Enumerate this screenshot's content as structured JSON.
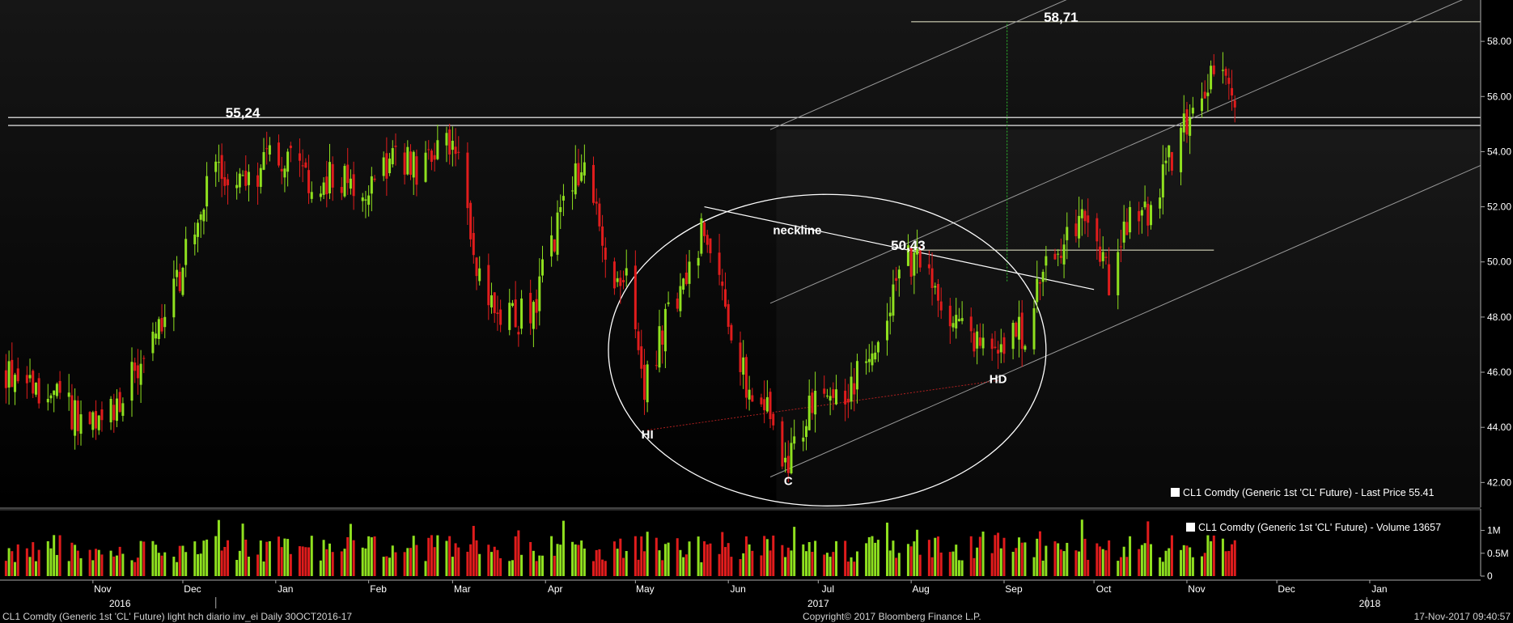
{
  "chart_data": {
    "type": "candlestick",
    "y_ticks": [
      "58.00",
      "56.00",
      "54.00",
      "52.00",
      "50.00",
      "48.00",
      "46.00",
      "44.00",
      "42.00"
    ],
    "y_tick_values": [
      58,
      56,
      54,
      52,
      50,
      48,
      46,
      44,
      42
    ],
    "ylim": [
      41.1,
      59.5
    ],
    "volume_ticks": [
      "1M",
      "0.5M",
      "0"
    ],
    "volume_tick_values": [
      1000000,
      500000,
      0
    ],
    "volume_lim": [
      0,
      1400000
    ],
    "x_months": [
      {
        "label": "Nov",
        "date": "2016-11-01"
      },
      {
        "label": "Dec",
        "date": "2016-12-01"
      },
      {
        "label": "Jan",
        "date": "2017-01-01"
      },
      {
        "label": "Feb",
        "date": "2017-02-01"
      },
      {
        "label": "Mar",
        "date": "2017-03-01"
      },
      {
        "label": "Apr",
        "date": "2017-04-01"
      },
      {
        "label": "May",
        "date": "2017-05-01"
      },
      {
        "label": "Jun",
        "date": "2017-06-01"
      },
      {
        "label": "Jul",
        "date": "2017-07-01"
      },
      {
        "label": "Aug",
        "date": "2017-08-01"
      },
      {
        "label": "Sep",
        "date": "2017-09-01"
      },
      {
        "label": "Oct",
        "date": "2017-10-01"
      },
      {
        "label": "Nov",
        "date": "2017-11-01"
      },
      {
        "label": "Dec",
        "date": "2017-12-01"
      },
      {
        "label": "Jan",
        "date": "2018-01-01"
      }
    ],
    "x_years": [
      {
        "label": "2016",
        "date": "2016-11-10"
      },
      {
        "label": "2017",
        "date": "2017-07-01"
      },
      {
        "label": "2018",
        "date": "2018-01-01"
      }
    ],
    "xlim": [
      "2016-10-01",
      "2018-02-07"
    ],
    "price_series": {
      "name": "CL1 Comdty (Generic 1st 'CL' Future) - Last Price 55.41",
      "points": [
        [
          "2016-10-01",
          46.2
        ],
        [
          "2016-10-20",
          45.0
        ],
        [
          "2016-11-03",
          43.8
        ],
        [
          "2016-11-14",
          45.8
        ],
        [
          "2016-11-25",
          47.8
        ],
        [
          "2016-11-30",
          49.4
        ],
        [
          "2016-12-06",
          51.8
        ],
        [
          "2016-12-12",
          53.2
        ],
        [
          "2016-12-22",
          52.8
        ],
        [
          "2016-12-30",
          53.7
        ],
        [
          "2017-01-06",
          53.8
        ],
        [
          "2017-01-13",
          52.4
        ],
        [
          "2017-01-20",
          53.1
        ],
        [
          "2017-01-31",
          52.8
        ],
        [
          "2017-02-10",
          53.8
        ],
        [
          "2017-02-17",
          53.4
        ],
        [
          "2017-02-27",
          54.1
        ],
        [
          "2017-03-03",
          53.5
        ],
        [
          "2017-03-08",
          50.3
        ],
        [
          "2017-03-14",
          48.3
        ],
        [
          "2017-03-22",
          47.9
        ],
        [
          "2017-03-28",
          48.4
        ],
        [
          "2017-04-04",
          51.0
        ],
        [
          "2017-04-11",
          53.4
        ],
        [
          "2017-04-17",
          52.7
        ],
        [
          "2017-04-21",
          49.6
        ],
        [
          "2017-04-28",
          49.3
        ],
        [
          "2017-05-04",
          45.5
        ],
        [
          "2017-05-11",
          47.8
        ],
        [
          "2017-05-18",
          49.3
        ],
        [
          "2017-05-24",
          51.4
        ],
        [
          "2017-05-31",
          48.3
        ],
        [
          "2017-06-07",
          45.7
        ],
        [
          "2017-06-14",
          44.7
        ],
        [
          "2017-06-21",
          42.5
        ],
        [
          "2017-06-28",
          44.6
        ],
        [
          "2017-07-05",
          45.2
        ],
        [
          "2017-07-12",
          45.4
        ],
        [
          "2017-07-19",
          46.8
        ],
        [
          "2017-07-26",
          48.7
        ],
        [
          "2017-07-31",
          50.2
        ],
        [
          "2017-08-07",
          49.4
        ],
        [
          "2017-08-14",
          47.6
        ],
        [
          "2017-08-21",
          47.4
        ],
        [
          "2017-08-28",
          46.4
        ],
        [
          "2017-09-01",
          47.3
        ],
        [
          "2017-09-08",
          47.5
        ],
        [
          "2017-09-15",
          49.9
        ],
        [
          "2017-09-22",
          50.7
        ],
        [
          "2017-09-29",
          51.7
        ],
        [
          "2017-10-06",
          49.3
        ],
        [
          "2017-10-13",
          51.5
        ],
        [
          "2017-10-20",
          51.7
        ],
        [
          "2017-10-27",
          53.9
        ],
        [
          "2017-11-03",
          55.6
        ],
        [
          "2017-11-10",
          56.7
        ],
        [
          "2017-11-13",
          56.8
        ],
        [
          "2017-11-17",
          55.4
        ]
      ]
    },
    "volume_series": {
      "name": "CL1 Comdty (Generic 1st 'CL' Future) - Volume 13657"
    },
    "annotations": [
      {
        "text": "55,24",
        "date": "2016-12-21",
        "value": 55.24
      },
      {
        "text": "58,71",
        "date": "2017-09-20",
        "value": 58.71
      },
      {
        "text": "50,43",
        "date": "2017-07-31",
        "value": 50.43
      },
      {
        "text": "neckline",
        "date": "2017-06-24",
        "value": 51.0
      },
      {
        "text": "HI",
        "date": "2017-05-05",
        "value": 43.6
      },
      {
        "text": "C",
        "date": "2017-06-21",
        "value": 41.9
      },
      {
        "text": "HD",
        "date": "2017-08-30",
        "value": 45.6
      }
    ],
    "resistance_lines": [
      55.24,
      54.95
    ],
    "level_lines": [
      {
        "value": 58.71,
        "from": "2017-08-01",
        "to": "2018-02-07"
      },
      {
        "value": 50.43,
        "from": "2017-07-31",
        "to": "2017-11-10"
      }
    ],
    "neckline": {
      "from": [
        "2017-05-24",
        52.0
      ],
      "to": [
        "2017-10-01",
        49.0
      ]
    },
    "channel_lines": [
      {
        "from": [
          "2017-06-15",
          42.2
        ],
        "to": [
          "2018-02-07",
          53.5
        ]
      },
      {
        "from": [
          "2017-06-15",
          48.5
        ],
        "to": [
          "2018-02-07",
          59.8
        ]
      },
      {
        "from": [
          "2017-06-15",
          54.8
        ],
        "to": [
          "2018-02-07",
          66.1
        ]
      }
    ],
    "support_dotted": {
      "from": [
        "2017-05-05",
        43.9
      ],
      "to": [
        "2017-08-30",
        45.7
      ]
    },
    "breakout_dotted": {
      "date": "2017-09-02",
      "from": 49.3,
      "to": 58.71
    },
    "ellipse": {
      "center_date": "2017-07-04",
      "center_value": 46.8,
      "half_width_days": 73,
      "half_height_value": 11.3
    },
    "shaded_region_start": "2017-06-17"
  },
  "footer": {
    "left": "CL1 Comdty (Generic 1st 'CL' Future) light hch diario inv_ei  Daily 30OCT2016-17",
    "center": "Copyright© 2017 Bloomberg Finance L.P.",
    "right": "17-Nov-2017 09:40:57"
  },
  "colors": {
    "up": "#8fe01f",
    "down": "#e01c1c",
    "background": "#000000",
    "lines": "#ffffff",
    "grid_text": "#ffffff"
  }
}
